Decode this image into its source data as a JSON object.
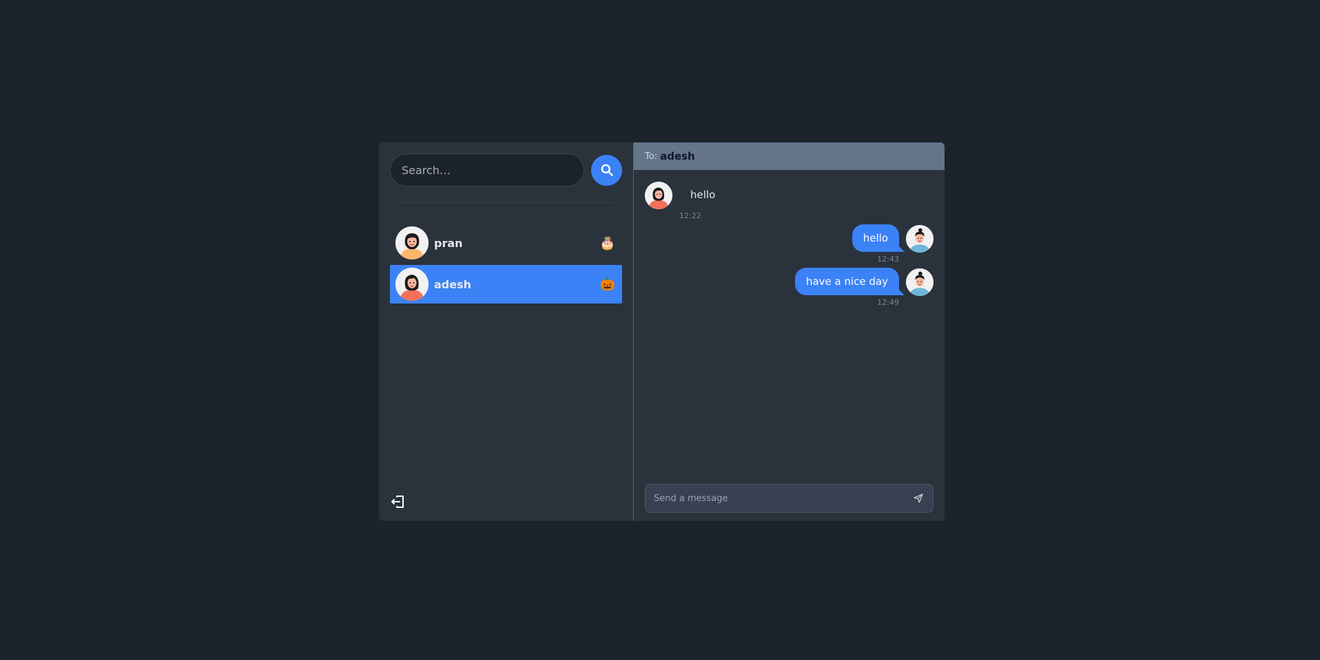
{
  "sidebar": {
    "search": {
      "placeholder": "Search…"
    },
    "conversations": [
      {
        "name": "pran",
        "emoji": "🎂",
        "active": false
      },
      {
        "name": "adesh",
        "emoji": "🎃",
        "active": true
      }
    ]
  },
  "chat": {
    "header": {
      "to_label": "To:",
      "recipient": "adesh"
    },
    "messages": [
      {
        "direction": "incoming",
        "text": "hello",
        "time": "12:22"
      },
      {
        "direction": "outgoing",
        "text": "hello",
        "time": "12:43"
      },
      {
        "direction": "outgoing",
        "text": "have a nice day",
        "time": "12:49"
      }
    ],
    "composer": {
      "placeholder": "Send a message"
    }
  },
  "colors": {
    "page_bg": "#1d232a",
    "panel_bg": "#2a323c",
    "accent": "#3b82f6",
    "header_bg": "#64748b"
  },
  "icons": {
    "search": "search-icon",
    "logout": "logout-icon",
    "send": "send-icon"
  }
}
